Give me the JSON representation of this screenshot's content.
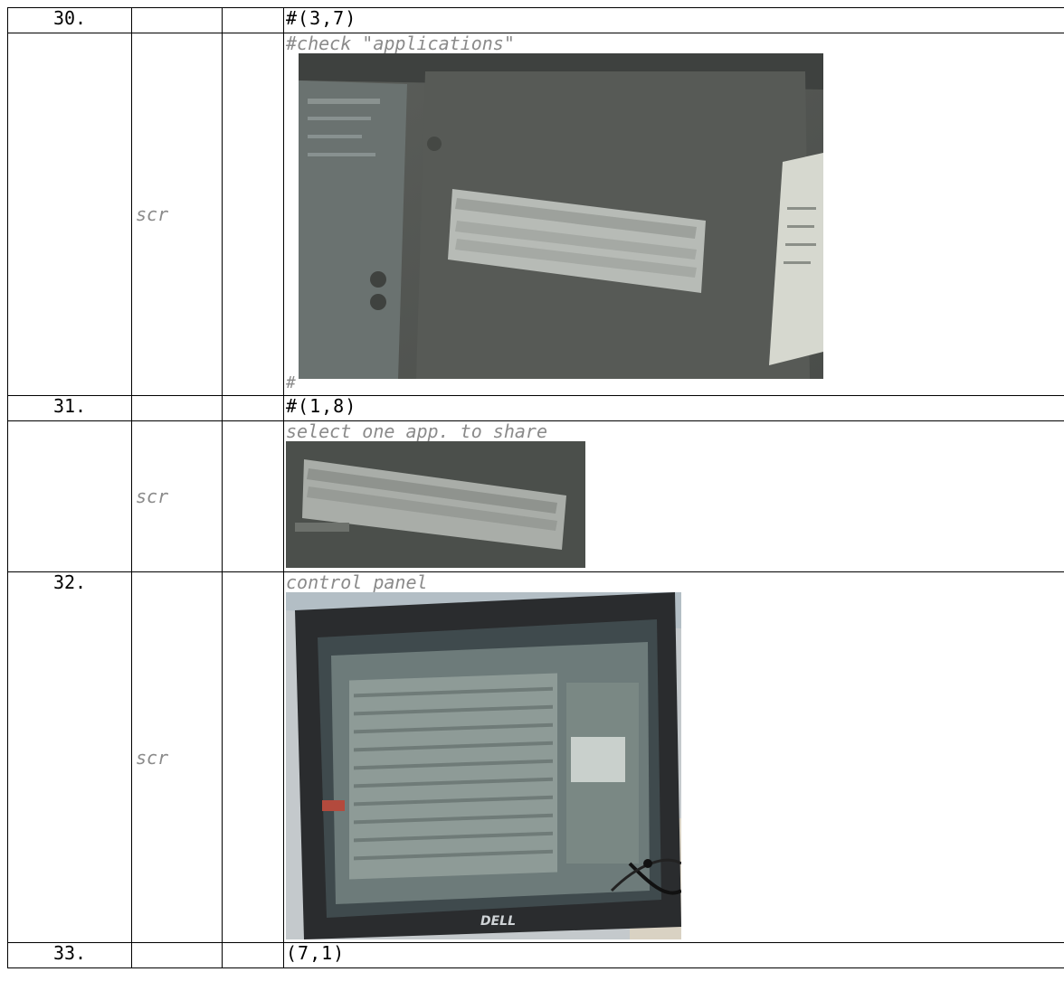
{
  "rows": [
    {
      "num": "30.",
      "command": "#(3,7)"
    },
    {
      "type": "scr",
      "comment": "#check \"applications\"",
      "trail": "#"
    },
    {
      "num": "31.",
      "command": "#(1,8)"
    },
    {
      "type": "scr",
      "comment": "select one app. to share"
    },
    {
      "num": "32.",
      "type": "scr",
      "comment": "control panel"
    },
    {
      "num": "33.",
      "command": "(7,1)"
    }
  ],
  "images": {
    "shot1": "photo of screen: dialog with applications list",
    "shot2": "photo crop: application list",
    "shot3": "photo of Dell laptop showing control panel"
  },
  "brand": {
    "laptop_logo": "DELL"
  }
}
